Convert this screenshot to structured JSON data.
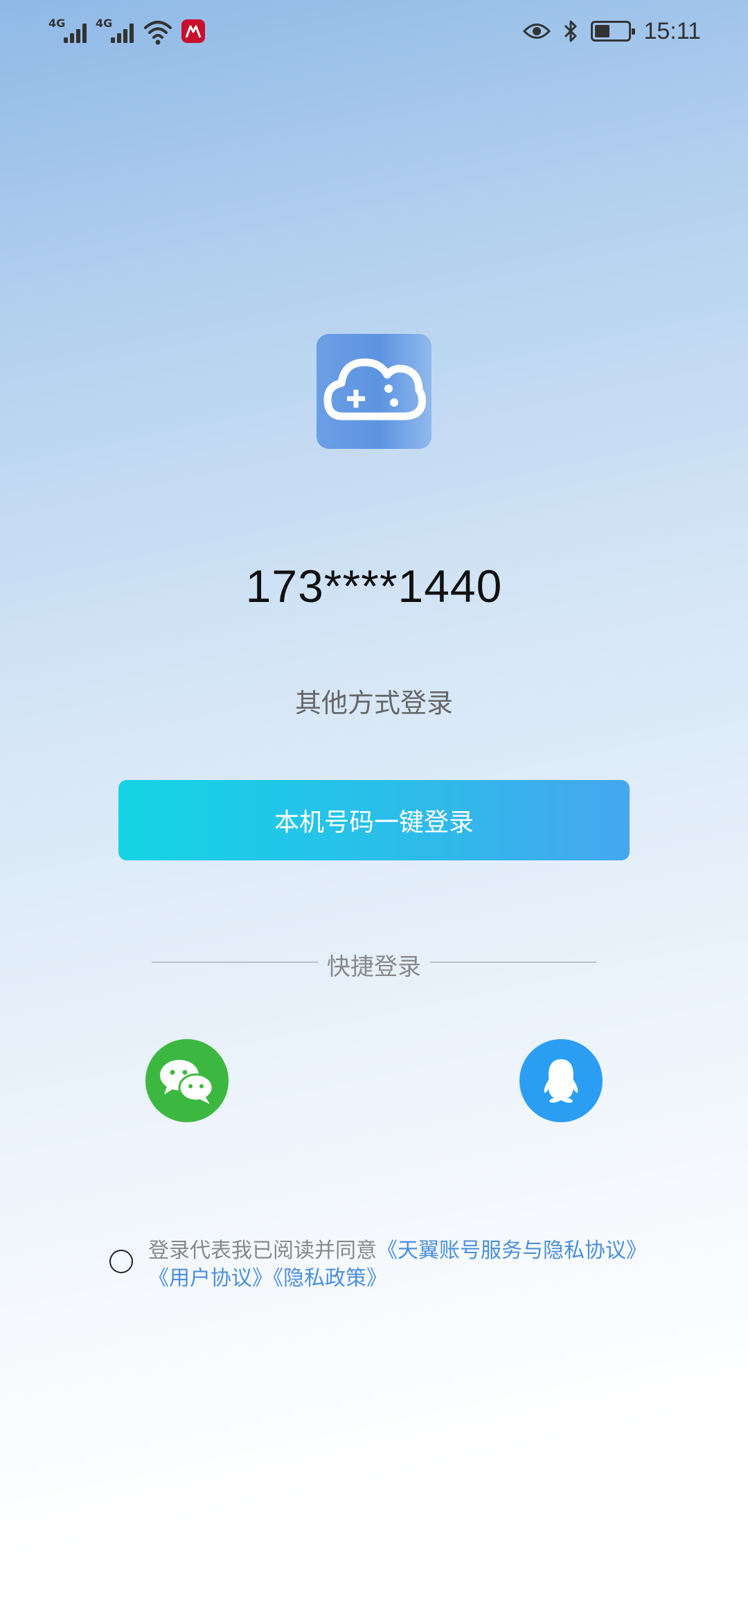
{
  "status_bar": {
    "network_1": "4G",
    "network_2": "4G",
    "time": "15:11",
    "battery_level": 0.45,
    "icons": [
      "signal-icon",
      "signal-icon",
      "wifi-icon",
      "app-notification-icon",
      "eye-icon",
      "bluetooth-icon",
      "battery-icon"
    ]
  },
  "app": {
    "logo_icon": "cloud-gamepad-icon"
  },
  "login": {
    "phone_number": "173****1440",
    "other_methods": "其他方式登录",
    "one_click_button": "本机号码一键登录",
    "quick_login_label": "快捷登录",
    "wechat_icon": "wechat-icon",
    "qq_icon": "qq-icon"
  },
  "agreement": {
    "prefix": "登录代表我已阅读并同意",
    "link_1": "《天翼账号服务与隐私协议》",
    "link_2": "《用户协议》",
    "link_3": "《隐私政策》"
  },
  "colors": {
    "button_start": "#14d4e4",
    "button_end": "#46a7ee",
    "wechat_green": "#3cb840",
    "qq_blue": "#2b9ef3",
    "link_blue": "#4a8fdc"
  }
}
